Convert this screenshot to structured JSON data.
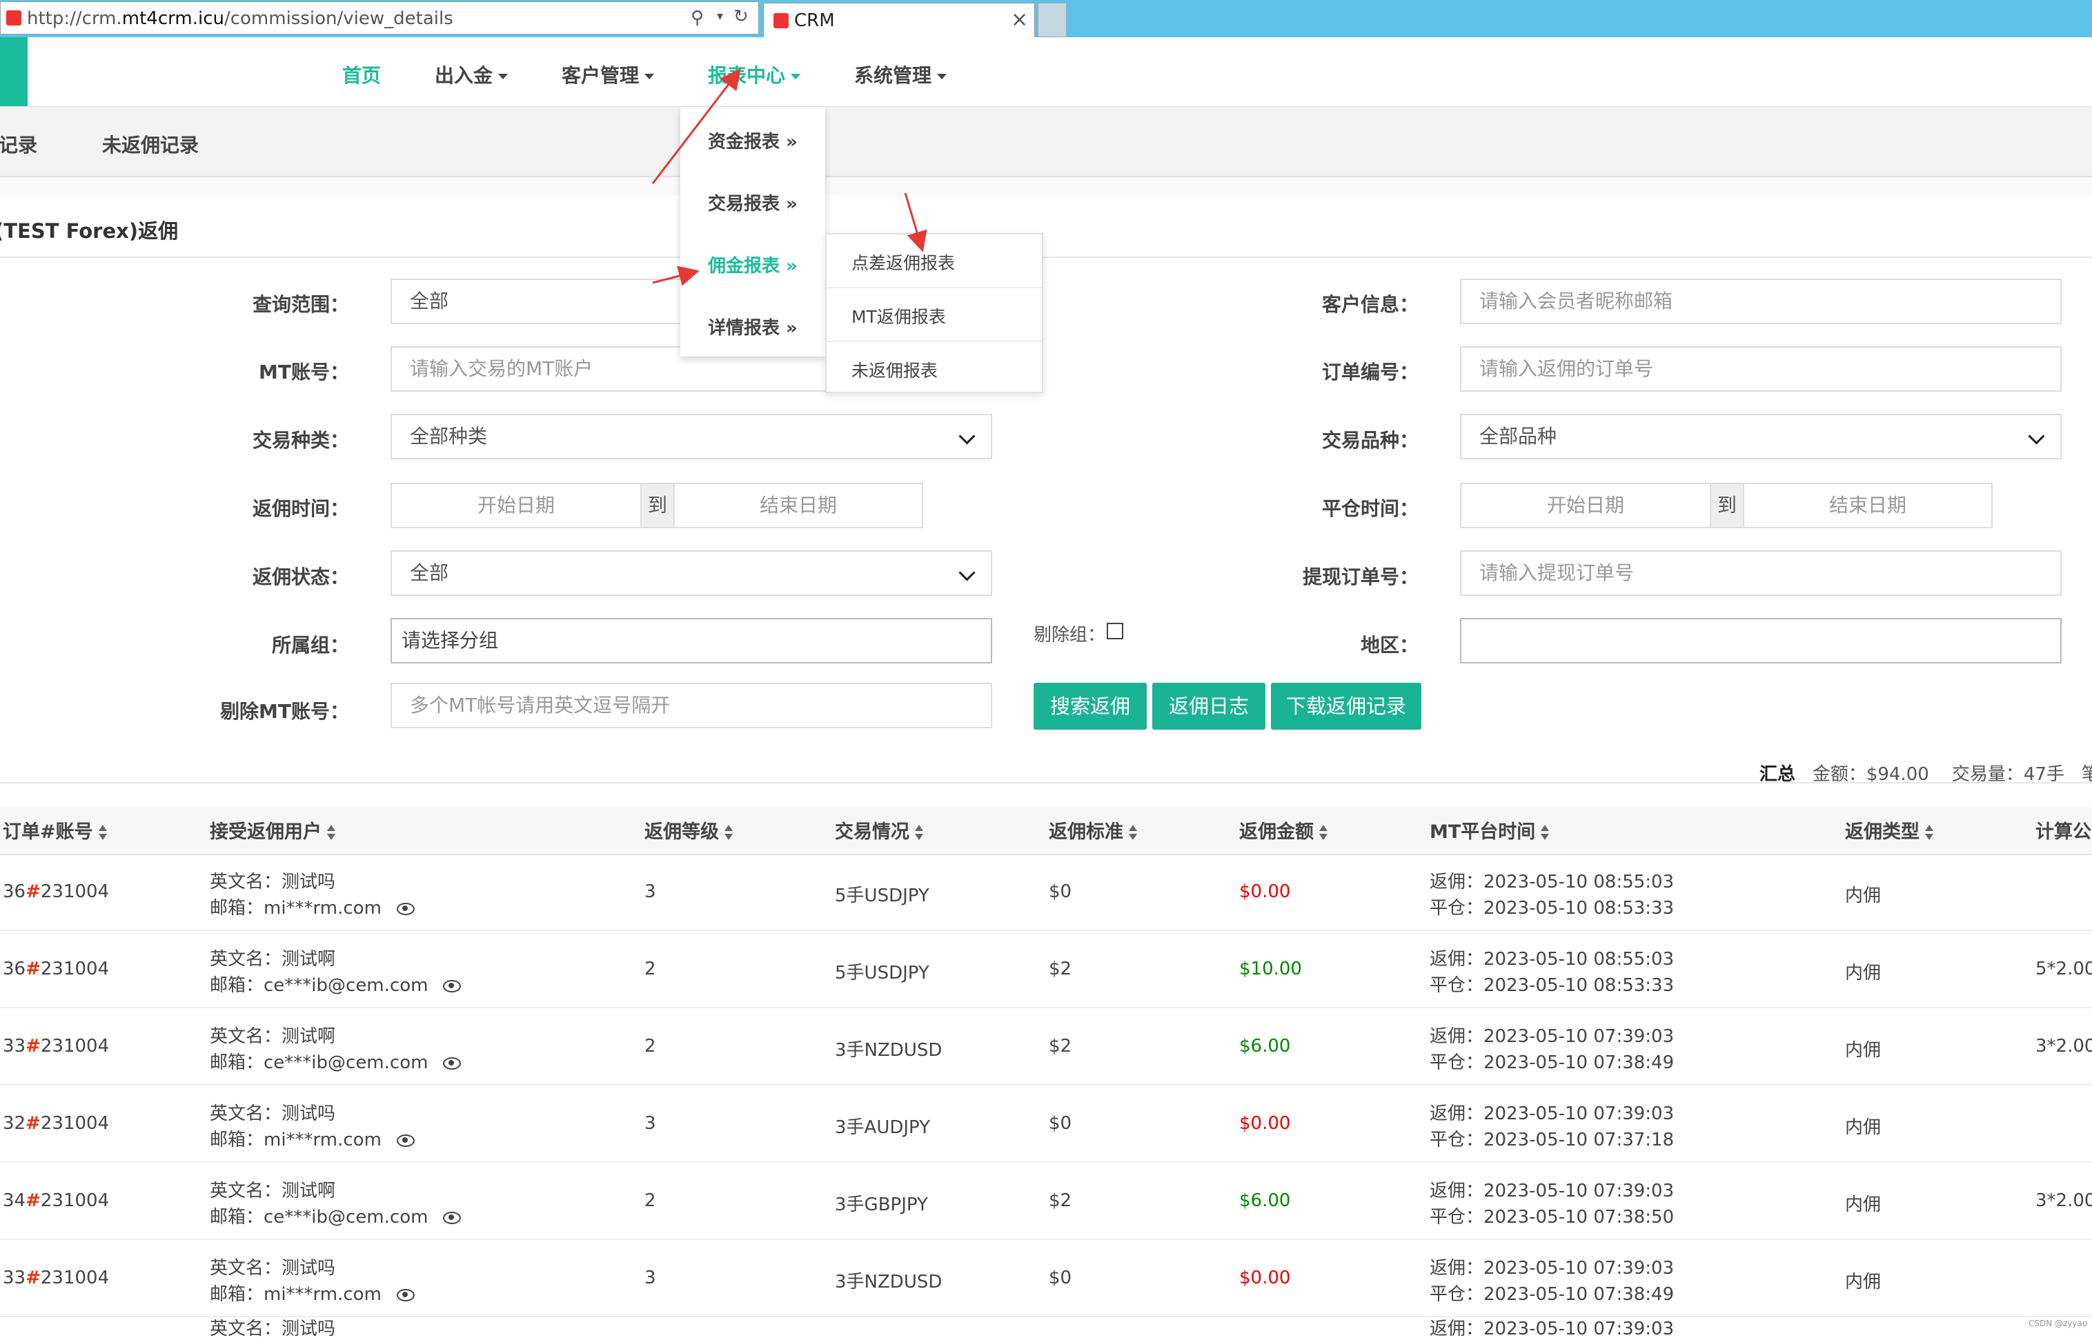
{
  "browser": {
    "url_prefix": "http://crm.",
    "url_domain": "mt4crm.icu",
    "url_path": "/commission/view_details",
    "tab_title": "CRM"
  },
  "nav": {
    "items": [
      {
        "label": "首页",
        "active": true,
        "caret": false
      },
      {
        "label": "出入金",
        "active": false,
        "caret": true
      },
      {
        "label": "客户管理",
        "active": false,
        "caret": true
      },
      {
        "label": "报表中心",
        "active": true,
        "caret": true
      },
      {
        "label": "系统管理",
        "active": false,
        "caret": true
      }
    ]
  },
  "report_menu": {
    "items": [
      "资金报表 »",
      "交易报表 »",
      "佣金报表 »",
      "详情报表 »"
    ],
    "active_index": 2
  },
  "commission_submenu": {
    "items": [
      "点差返佣报表",
      "MT返佣报表",
      "未返佣报表"
    ]
  },
  "page_tabs": [
    "佣记录",
    "未返佣记录"
  ],
  "panel_title": "(TEST Forex)返佣",
  "form": {
    "query_scope": {
      "label": "查询范围：",
      "value": "全部"
    },
    "mt_account": {
      "label": "MT账号：",
      "placeholder": "请输入交易的MT账户"
    },
    "trade_type": {
      "label": "交易种类：",
      "value": "全部种类"
    },
    "commission_time": {
      "label": "返佣时间：",
      "start": "开始日期",
      "sep": "到",
      "end": "结束日期"
    },
    "commission_status": {
      "label": "返佣状态：",
      "value": "全部"
    },
    "group": {
      "label": "所属组：",
      "placeholder": "请选择分组"
    },
    "exclude_group": {
      "label": "剔除组："
    },
    "exclude_mt": {
      "label": "剔除MT账号：",
      "placeholder": "多个MT帐号请用英文逗号隔开"
    },
    "customer_info": {
      "label": "客户信息：",
      "placeholder": "请输入会员者昵称邮箱"
    },
    "order_no": {
      "label": "订单编号：",
      "placeholder": "请输入返佣的订单号"
    },
    "symbol": {
      "label": "交易品种：",
      "value": "全部品种"
    },
    "close_time": {
      "label": "平仓时间：",
      "start": "开始日期",
      "sep": "到",
      "end": "结束日期"
    },
    "withdraw_no": {
      "label": "提现订单号：",
      "placeholder": "请输入提现订单号"
    },
    "region": {
      "label": "地区："
    }
  },
  "buttons": {
    "search": "搜索返佣",
    "log": "返佣日志",
    "download": "下载返佣记录"
  },
  "summary": {
    "label": "汇总",
    "amount": "金额：$94.00",
    "volume": "交易量：47手",
    "count": "笔数"
  },
  "table": {
    "headers": [
      "订单#账号",
      "接受返佣用户",
      "返佣等级",
      "交易情况",
      "返佣标准",
      "返佣金额",
      "MT平台时间",
      "返佣类型",
      "计算公"
    ],
    "rows": [
      {
        "order_prefix": "36",
        "account": "231004",
        "name": "英文名：测试吗",
        "email": "邮箱：mi***rm.com",
        "level": "3",
        "trade": "5手USDJPY",
        "standard": "$0",
        "amount": "$0.00",
        "amount_positive": false,
        "rebate_time": "返佣：2023-05-10 08:55:03",
        "close_time": "平仓：2023-05-10 08:53:33",
        "type": "内佣",
        "formula": ""
      },
      {
        "order_prefix": "36",
        "account": "231004",
        "name": "英文名：测试啊",
        "email": "邮箱：ce***ib@cem.com",
        "level": "2",
        "trade": "5手USDJPY",
        "standard": "$2",
        "amount": "$10.00",
        "amount_positive": true,
        "rebate_time": "返佣：2023-05-10 08:55:03",
        "close_time": "平仓：2023-05-10 08:53:33",
        "type": "内佣",
        "formula": "5*2.00"
      },
      {
        "order_prefix": "33",
        "account": "231004",
        "name": "英文名：测试啊",
        "email": "邮箱：ce***ib@cem.com",
        "level": "2",
        "trade": "3手NZDUSD",
        "standard": "$2",
        "amount": "$6.00",
        "amount_positive": true,
        "rebate_time": "返佣：2023-05-10 07:39:03",
        "close_time": "平仓：2023-05-10 07:38:49",
        "type": "内佣",
        "formula": "3*2.00"
      },
      {
        "order_prefix": "32",
        "account": "231004",
        "name": "英文名：测试吗",
        "email": "邮箱：mi***rm.com",
        "level": "3",
        "trade": "3手AUDJPY",
        "standard": "$0",
        "amount": "$0.00",
        "amount_positive": false,
        "rebate_time": "返佣：2023-05-10 07:39:03",
        "close_time": "平仓：2023-05-10 07:37:18",
        "type": "内佣",
        "formula": ""
      },
      {
        "order_prefix": "34",
        "account": "231004",
        "name": "英文名：测试啊",
        "email": "邮箱：ce***ib@cem.com",
        "level": "2",
        "trade": "3手GBPJPY",
        "standard": "$2",
        "amount": "$6.00",
        "amount_positive": true,
        "rebate_time": "返佣：2023-05-10 07:39:03",
        "close_time": "平仓：2023-05-10 07:38:50",
        "type": "内佣",
        "formula": "3*2.00"
      },
      {
        "order_prefix": "33",
        "account": "231004",
        "name": "英文名：测试吗",
        "email": "邮箱：mi***rm.com",
        "level": "3",
        "trade": "3手NZDUSD",
        "standard": "$0",
        "amount": "$0.00",
        "amount_positive": false,
        "rebate_time": "返佣：2023-05-10 07:39:03",
        "close_time": "平仓：2023-05-10 07:38:49",
        "type": "内佣",
        "formula": ""
      }
    ],
    "partial_row": {
      "name": "英文名：测试吗",
      "rebate_time": "返佣：2023-05-10 07:39:03"
    }
  },
  "colors": {
    "accent": "#1abc9c",
    "button": "#1ab394",
    "amount_zero": "#e00000",
    "amount_positive": "#008800",
    "order_hash": "#e31111",
    "annotation_arrow": "#e53935"
  },
  "watermark": "CSDN @zyyao"
}
